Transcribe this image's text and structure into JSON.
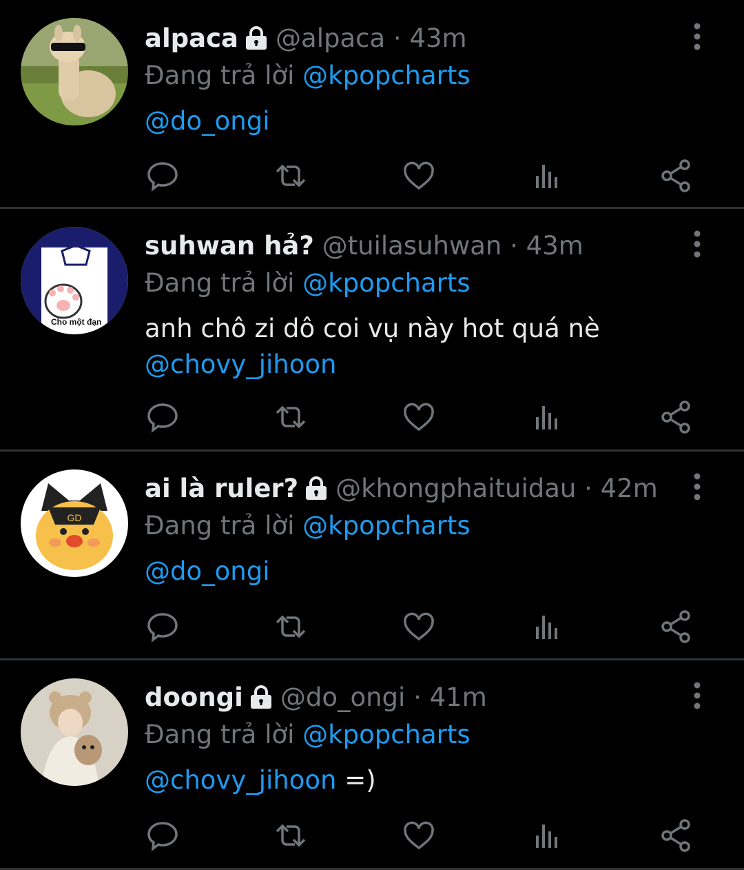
{
  "colors": {
    "background": "#000000",
    "name": "#e7e9ea",
    "muted": "#71767b",
    "mention": "#1d9bf0",
    "divider": "#2f3336"
  },
  "tweets": [
    {
      "display_name": "alpaca",
      "handle": "@alpaca",
      "time": "· 43m",
      "protected": true,
      "reply_prefix": "Đang trả lời",
      "reply_to": "@kpopcharts",
      "text": "",
      "mention": "@do_ongi",
      "suffix": "",
      "avatar_icon": "alpaca-avatar"
    },
    {
      "display_name": "suhwan hả?",
      "handle": "@tuilasuhwan",
      "time": "· 43m",
      "protected": false,
      "reply_prefix": "Đang trả lời",
      "reply_to": "@kpopcharts",
      "text": "anh chô zi dô coi vụ này hot quá nè",
      "mention": "@chovy_jihoon",
      "suffix": "",
      "avatar_icon": "cat-paw-avatar",
      "avatar_text": "Cho một đạn"
    },
    {
      "display_name": "ai là ruler?",
      "handle": "@khongphaituidau",
      "time": "· 42m",
      "protected": true,
      "reply_prefix": "Đang trả lời",
      "reply_to": "@kpopcharts",
      "text": "",
      "mention": "@do_ongi",
      "suffix": "",
      "avatar_icon": "fox-mascot-avatar"
    },
    {
      "display_name": "doongi",
      "handle": "@do_ongi",
      "time": "· 41m",
      "protected": true,
      "reply_prefix": "Đang trả lời",
      "reply_to": "@kpopcharts",
      "text": "",
      "mention": "@chovy_jihoon",
      "suffix": " =)",
      "avatar_icon": "person-with-dog-avatar"
    }
  ],
  "action_icons": [
    "reply-icon",
    "retweet-icon",
    "like-icon",
    "views-icon",
    "share-icon"
  ]
}
